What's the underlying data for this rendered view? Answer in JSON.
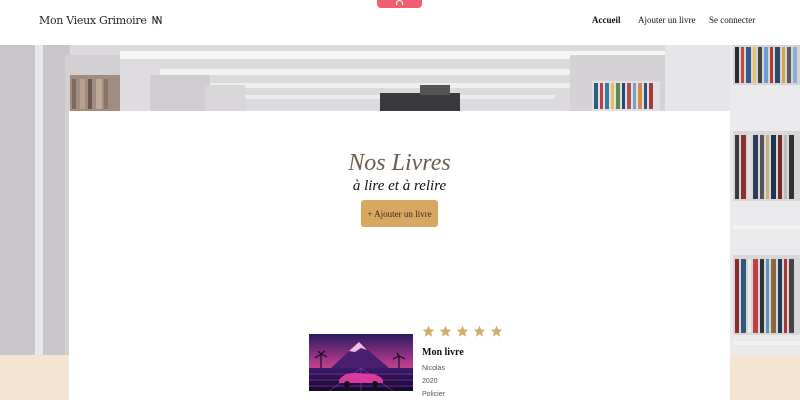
{
  "app": {
    "logo_text": "Mon Vieux Grimoire"
  },
  "nav": {
    "items": [
      {
        "label": "Accueil",
        "active": true
      },
      {
        "label": "Ajouter un livre",
        "active": false
      },
      {
        "label": "Se connecter",
        "active": false
      }
    ]
  },
  "hero": {
    "title": "Nos Livres",
    "subtitle": "à lire et à relire",
    "add_button_label": "+ Ajouter un livre"
  },
  "books": [
    {
      "title": "Mon livre",
      "author": "Nicolas",
      "year": "2020",
      "genre": "Policier",
      "rating": 5,
      "max_rating": 5
    }
  ],
  "colors": {
    "accent_button": "#d8a860",
    "title": "#6e5b52",
    "star": "#d2ad6a",
    "top_tab": "#f06070",
    "beige_band": "#f4e5d2"
  }
}
